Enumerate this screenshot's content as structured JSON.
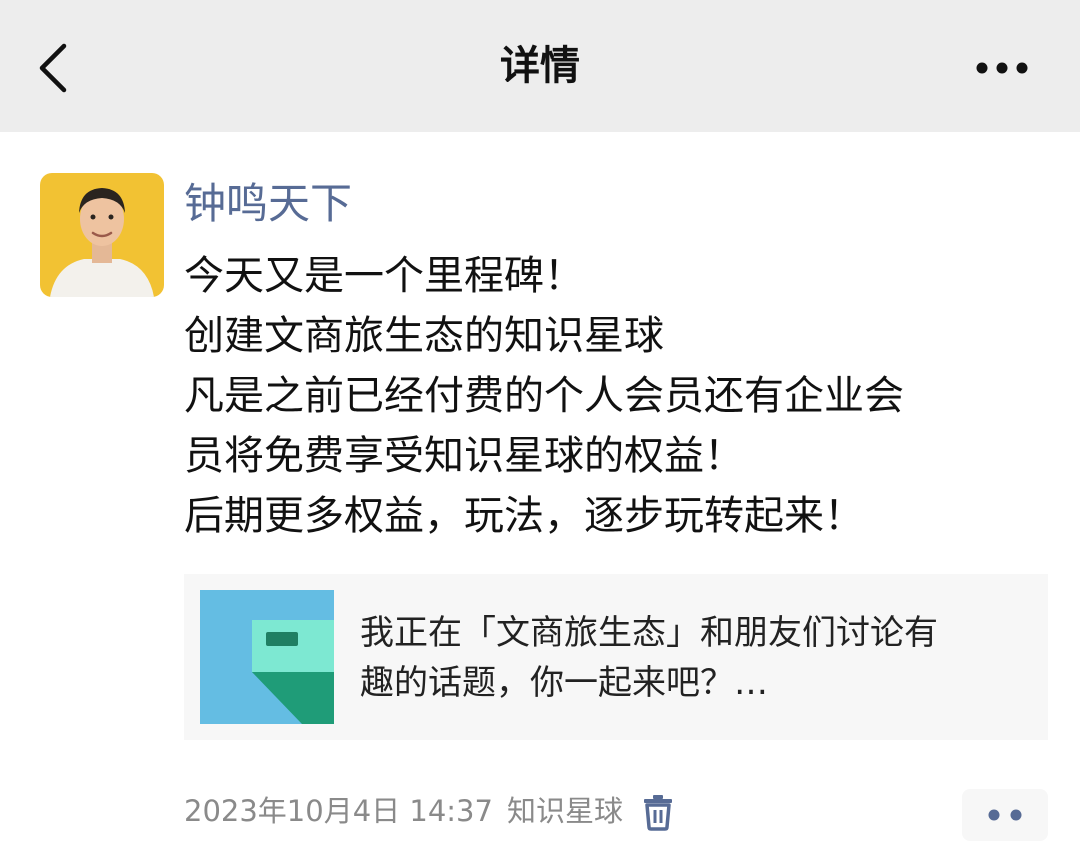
{
  "header": {
    "title": "详情",
    "back_icon": "chevron-left-icon",
    "more_icon": "more-horizontal-icon"
  },
  "post": {
    "author": "钟鸣天下",
    "avatar": "avatar-photo",
    "lines": [
      "今天又是一个里程碑！",
      "创建文商旅生态的知识星球",
      "凡是之前已经付费的个人会员还有企业会",
      "员将免费享受知识星球的权益！",
      "后期更多权益，玩法，逐步玩转起来！"
    ],
    "share_card": {
      "thumbnail": "knowledge-planet-logo",
      "lines": [
        "我正在「文商旅生态」和朋友们讨论有",
        "趣的话题，你一起来吧？…"
      ]
    },
    "meta": {
      "time": "2023年10月4日 14:37",
      "source": "知识星球"
    }
  },
  "colors": {
    "author": "#576b95",
    "header_bg": "#ededed",
    "card_bg": "#f7f7f7",
    "meta": "#8a8a8a"
  }
}
